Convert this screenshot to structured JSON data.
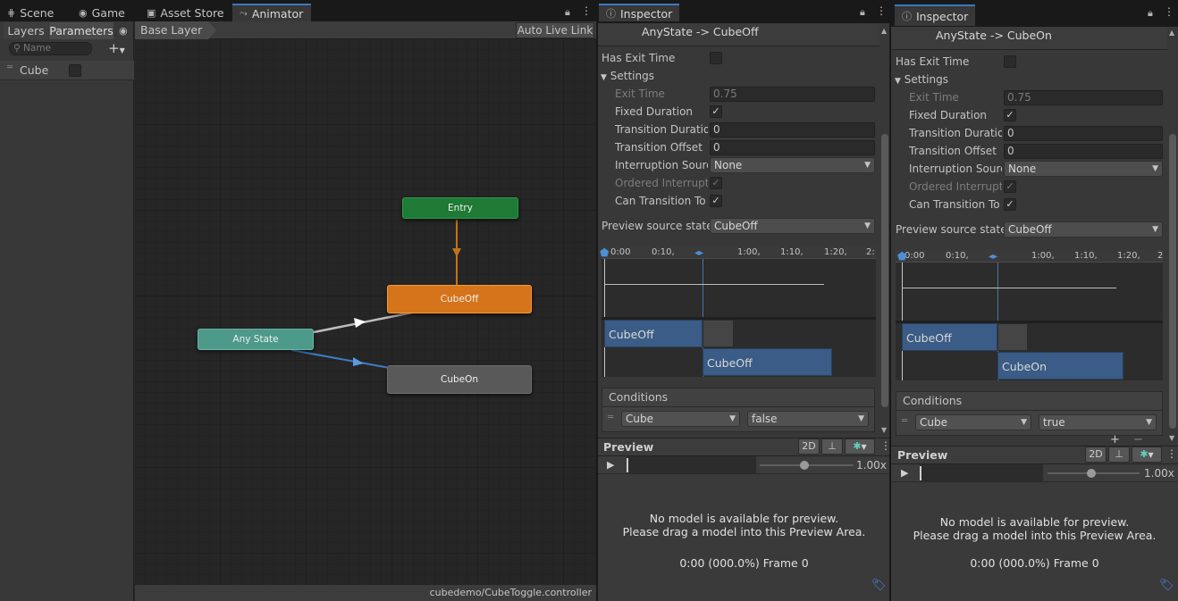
{
  "tabs": {
    "scene": "Scene",
    "game": "Game",
    "asset_store": "Asset Store",
    "animator": "Animator",
    "inspector": "Inspector"
  },
  "animator": {
    "layers_tab": "Layers",
    "parameters_tab": "Parameters",
    "search_placeholder": "Name",
    "breadcrumb": "Base Layer",
    "auto_live_link": "Auto Live Link",
    "param_name": "Cube",
    "param_value": false,
    "nodes": {
      "entry": "Entry",
      "cube_off": "CubeOff",
      "any_state": "Any State",
      "cube_on": "CubeOn"
    },
    "footer_path": "cubedemo/CubeToggle.controller",
    "colors": {
      "entry": "#1e7a34",
      "cube_off": "#d5741a",
      "any_state": "#4d9a8a",
      "cube_on": "#595959",
      "entry_arrow": "#c17416"
    }
  },
  "inspector1": {
    "title": "AnyState -> CubeOff",
    "has_exit_time": "Has Exit Time",
    "has_exit_time_checked": false,
    "settings": "Settings",
    "exit_time": "Exit Time",
    "exit_time_value": "0.75",
    "fixed_duration": "Fixed Duration",
    "fixed_duration_checked": true,
    "transition_duration": "Transition Duration",
    "transition_duration_value": "0",
    "transition_offset": "Transition Offset",
    "transition_offset_value": "0",
    "interruption_source": "Interruption Source",
    "interruption_source_value": "None",
    "ordered_interruption": "Ordered Interruption",
    "ordered_interruption_checked": true,
    "can_transition": "Can Transition To Self",
    "can_transition_checked": true,
    "preview_source": "Preview source state",
    "preview_source_value": "CubeOff",
    "timeline_ticks": [
      "0:00",
      "0:10,",
      "1:00,",
      "1:10,",
      "1:20,",
      "2:"
    ],
    "bar_from": "CubeOff",
    "bar_to": "CubeOff",
    "conditions": "Conditions",
    "cond_param": "Cube",
    "cond_value": "false",
    "preview": "Preview",
    "mode_2d": "2D",
    "speed": "1.00x",
    "no_model_1": "No model is available for preview.",
    "no_model_2": "Please drag a model into this Preview Area.",
    "frame": "0:00 (000.0%) Frame 0"
  },
  "inspector2": {
    "title": "AnyState -> CubeOn",
    "has_exit_time": "Has Exit Time",
    "has_exit_time_checked": false,
    "settings": "Settings",
    "exit_time": "Exit Time",
    "exit_time_value": "0.75",
    "fixed_duration": "Fixed Duration",
    "fixed_duration_checked": true,
    "transition_duration": "Transition Duration",
    "transition_duration_value": "0",
    "transition_offset": "Transition Offset",
    "transition_offset_value": "0",
    "interruption_source": "Interruption Source",
    "interruption_source_value": "None",
    "ordered_interruption": "Ordered Interruption",
    "ordered_interruption_checked": true,
    "can_transition": "Can Transition To Self",
    "can_transition_checked": true,
    "preview_source": "Preview source state",
    "preview_source_value": "CubeOff",
    "timeline_ticks": [
      "0:00",
      "0:10,",
      "1:00,",
      "1:10,",
      "1:20,",
      "2"
    ],
    "bar_from": "CubeOff",
    "bar_to": "CubeOn",
    "conditions": "Conditions",
    "cond_param": "Cube",
    "cond_value": "true",
    "add_symbol": "+",
    "remove_symbol": "−",
    "preview": "Preview",
    "mode_2d": "2D",
    "speed": "1.00x",
    "no_model_1": "No model is available for preview.",
    "no_model_2": "Please drag a model into this Preview Area.",
    "frame": "0:00 (000.0%) Frame 0"
  }
}
